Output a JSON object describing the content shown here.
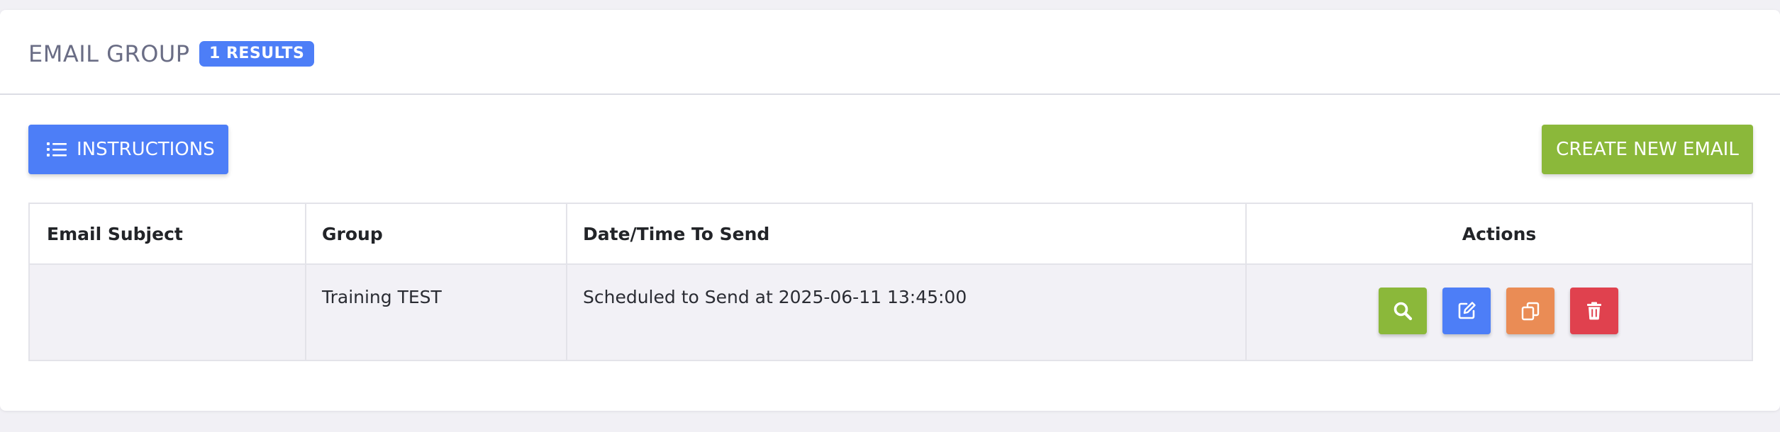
{
  "header": {
    "title": "EMAIL GROUP",
    "badge": "1 RESULTS"
  },
  "toolbar": {
    "instructions_label": "INSTRUCTIONS",
    "instructions_icon": "list-icon",
    "create_label": "CREATE NEW EMAIL"
  },
  "table": {
    "columns": [
      "Email Subject",
      "Group",
      "Date/Time To Send",
      "Actions"
    ],
    "rows": [
      {
        "email_subject": "",
        "group": "Training TEST",
        "date_time": "Scheduled to Send at 2025-06-11 13:45:00",
        "actions": [
          "search-icon",
          "edit-icon",
          "copy-icon",
          "trash-icon"
        ]
      }
    ]
  },
  "colors": {
    "primary": "#4d7ef7",
    "success": "#8bb83a",
    "warning": "#ea8c55",
    "danger": "#e0414e",
    "title": "#6a6d85",
    "background": "#f1f0f5"
  }
}
